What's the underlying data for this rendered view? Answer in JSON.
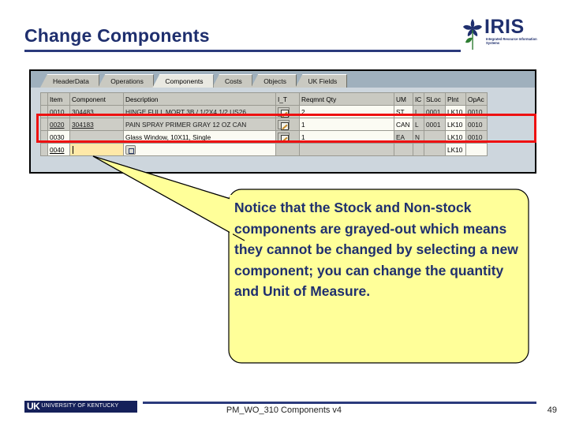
{
  "slide": {
    "title": "Change Components",
    "page_number": "49",
    "footer_caption": "PM_WO_310 Components v4",
    "accent_color": "#1f2f6e",
    "highlight_color": "#ee1111",
    "callout_fill": "#ffff99"
  },
  "logo": {
    "iris_wordmark": "IRIS",
    "iris_tagline": "Integrated Resource Information Systems",
    "uk_mark": "UK",
    "uk_name": "UNIVERSITY OF KENTUCKY"
  },
  "sap": {
    "tabs": [
      {
        "label": "HeaderData",
        "active": false
      },
      {
        "label": "Operations",
        "active": false
      },
      {
        "label": "Components",
        "active": true
      },
      {
        "label": "Costs",
        "active": false
      },
      {
        "label": "Objects",
        "active": false
      },
      {
        "label": "UK Fields",
        "active": false
      }
    ],
    "columns": [
      "Item",
      "Component",
      "Description",
      "I_T",
      "Reqmnt Qty",
      "UM",
      "IC",
      "SLoc",
      "Plnt",
      "OpAc"
    ],
    "rows": [
      {
        "item": "0010",
        "component": "304483",
        "description": "HINGE FULL MORT 3B / 1/2X4 1/2 US26..",
        "qty": "2",
        "um": "ST",
        "ic": "L",
        "sloc": "0001",
        "plnt": "LK10",
        "opac": "0010",
        "grayed": true,
        "highlighted": true
      },
      {
        "item": "0020",
        "component": "304183",
        "description": "PAIN  SPRAY PRIMER GRAY 12 OZ CAN",
        "qty": "1",
        "um": "CAN",
        "ic": "L",
        "sloc": "0001",
        "plnt": "LK10",
        "opac": "0010",
        "grayed": true,
        "highlighted": true
      },
      {
        "item": "0030",
        "component": "",
        "description": "Glass Window, 10X11, Single",
        "qty": "1",
        "um": "EA",
        "ic": "N",
        "sloc": "",
        "plnt": "LK10",
        "opac": "0010",
        "grayed": false,
        "highlighted": false
      },
      {
        "item": "0040",
        "component": "",
        "description": "",
        "qty": "",
        "um": "",
        "ic": "",
        "sloc": "",
        "plnt": "LK10",
        "opac": "",
        "grayed": false,
        "highlighted": false
      }
    ]
  },
  "callout": {
    "text": "Notice that the Stock and Non-stock components are grayed-out which means they cannot be changed by selecting a new component; you can change the quantity and Unit of Measure."
  }
}
